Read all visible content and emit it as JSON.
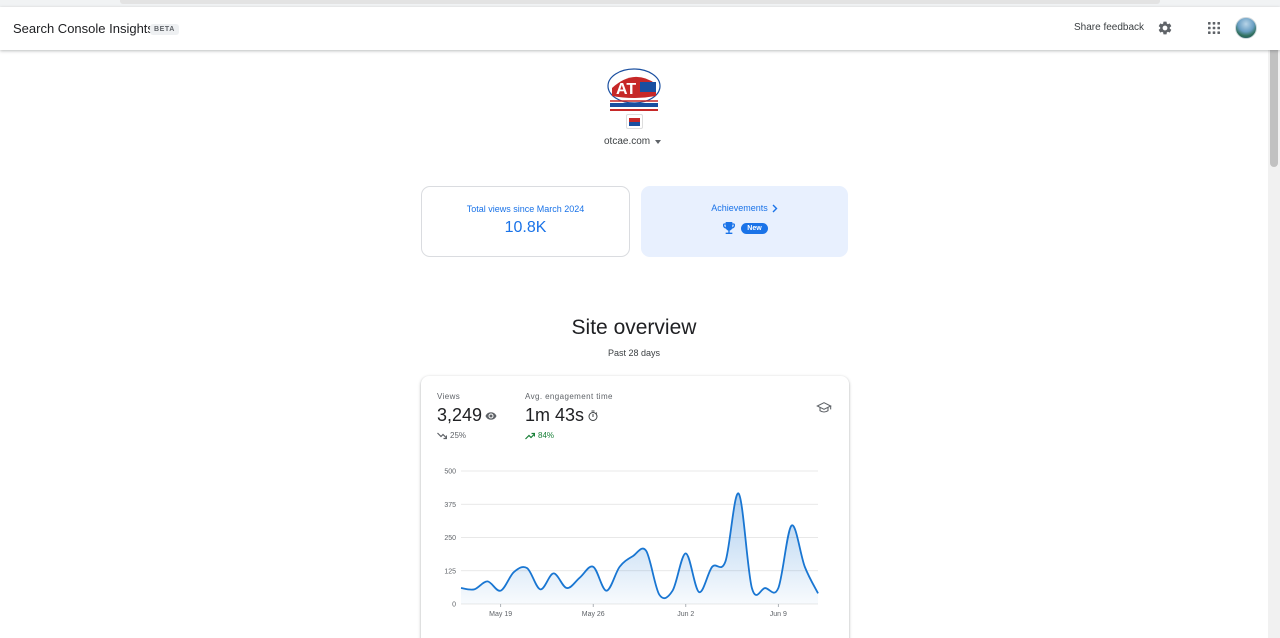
{
  "app": {
    "title": "Search Console Insights",
    "badge": "BETA",
    "share_feedback": "Share feedback",
    "icons": {
      "settings": "gear-icon",
      "apps": "apps-grid-icon",
      "account": "avatar"
    }
  },
  "site": {
    "logo_alt": "site-logo",
    "domain": "otcae.com"
  },
  "cards": {
    "total_views": {
      "label": "Total views since March 2024",
      "value": "10.8K"
    },
    "achievements": {
      "label": "Achievements",
      "badge": "New",
      "icon": "trophy-icon"
    }
  },
  "overview": {
    "title": "Site overview",
    "subtitle": "Past 28 days",
    "metrics": {
      "views": {
        "label": "Views",
        "value": "3,249",
        "change": "25%",
        "trend": "down",
        "icon": "eye-icon"
      },
      "engagement": {
        "label": "Avg. engagement time",
        "value": "1m 43s",
        "change": "84%",
        "trend": "up",
        "icon": "timer-icon"
      }
    }
  },
  "colors": {
    "accent": "#1a73e8",
    "positive": "#188038",
    "line": "#1976d2"
  },
  "chart_data": {
    "type": "area",
    "ylim": [
      0,
      500
    ],
    "y_ticks": [
      0,
      125,
      250,
      375,
      500
    ],
    "y_tick_labels": [
      "0",
      "125",
      "250",
      "375",
      "500"
    ],
    "x_tick_labels": [
      {
        "label": "May 19",
        "index": 3
      },
      {
        "label": "May 26",
        "index": 10
      },
      {
        "label": "Jun 2",
        "index": 17
      },
      {
        "label": "Jun 9",
        "index": 24
      }
    ],
    "series": [
      {
        "values": [
          60,
          55,
          85,
          50,
          120,
          135,
          55,
          115,
          60,
          100,
          140,
          50,
          140,
          180,
          200,
          35,
          50,
          190,
          45,
          140,
          160,
          415,
          60,
          60,
          60,
          295,
          140,
          40
        ]
      }
    ]
  }
}
